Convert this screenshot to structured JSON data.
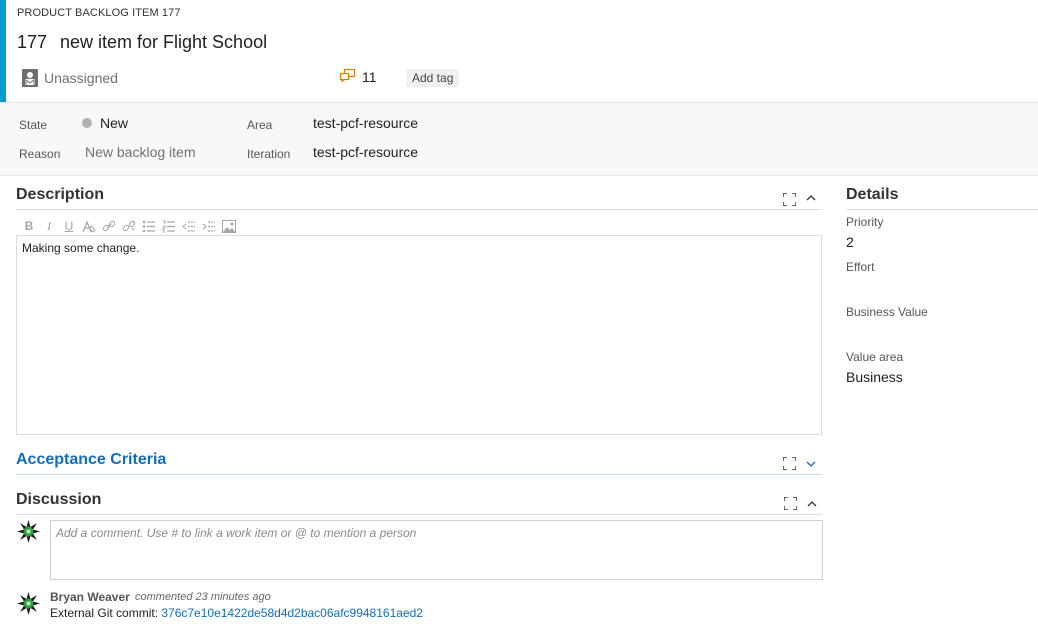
{
  "header": {
    "work_item_type": "PRODUCT BACKLOG ITEM 177",
    "id": "177",
    "title": "new item for Flight School",
    "assignee": "Unassigned",
    "comment_count": "11",
    "add_tag_label": "Add tag",
    "accent_color": "#009ccc"
  },
  "fields": {
    "state_label": "State",
    "state_value": "New",
    "reason_label": "Reason",
    "reason_value": "New backlog item",
    "area_label": "Area",
    "area_value": "test-pcf-resource",
    "iteration_label": "Iteration",
    "iteration_value": "test-pcf-resource"
  },
  "description": {
    "title": "Description",
    "toolbar_icons": [
      "bold-icon",
      "italic-icon",
      "underline-icon",
      "highlight-icon",
      "link-icon",
      "unlink-icon",
      "bullet-list-icon",
      "numbered-list-icon",
      "outdent-icon",
      "indent-icon",
      "image-icon"
    ],
    "body": "Making some change."
  },
  "acceptance": {
    "title": "Acceptance Criteria"
  },
  "discussion": {
    "title": "Discussion",
    "placeholder": "Add a comment. Use # to link a work item or @ to mention a person",
    "comments": [
      {
        "author": "Bryan Weaver",
        "meta": "commented 23 minutes ago",
        "prefix": "External Git commit: ",
        "commit": "376c7e10e1422de58d4d2bac06afc9948161aed2"
      }
    ]
  },
  "details": {
    "title": "Details",
    "priority_label": "Priority",
    "priority_value": "2",
    "effort_label": "Effort",
    "effort_value": "",
    "business_value_label": "Business Value",
    "business_value_value": "",
    "value_area_label": "Value area",
    "value_area_value": "Business"
  }
}
